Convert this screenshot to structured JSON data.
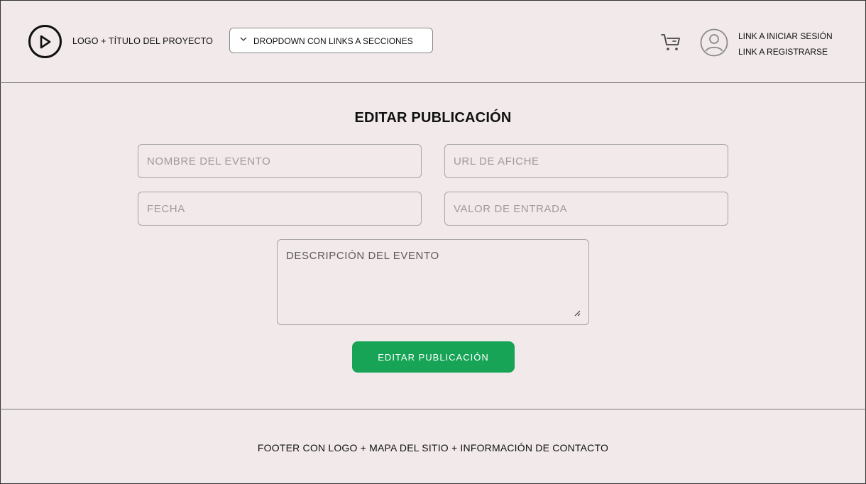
{
  "header": {
    "logo_title": "LOGO + TÍTULO DEL PROYECTO",
    "dropdown_label": "DROPDOWN CON LINKS A SECCIONES",
    "login_link": "LINK A INICIAR SESIÓN",
    "register_link": "LINK A REGISTRARSE",
    "icons": [
      "play-icon",
      "chevron-down-icon",
      "cart-icon",
      "user-avatar-icon"
    ]
  },
  "main": {
    "title": "EDITAR PUBLICACIÓN",
    "fields": {
      "nombre_placeholder": "NOMBRE DEL EVENTO",
      "url_placeholder": "URL DE AFICHE",
      "fecha_placeholder": "FECHA",
      "valor_placeholder": "VALOR DE ENTRADA",
      "descripcion_placeholder": "DESCRIPCIÓN DEL EVENTO"
    },
    "submit_label": "EDITAR PUBLICACIÓN",
    "accent_color": "#17a457"
  },
  "footer": {
    "text": "FOOTER CON LOGO + MAPA DEL SITIO + INFORMACIÓN DE CONTACTO"
  }
}
